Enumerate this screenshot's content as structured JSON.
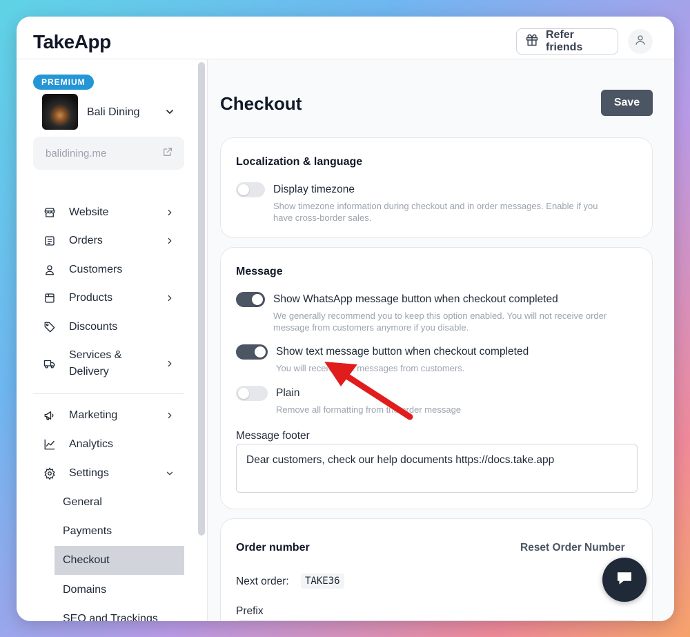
{
  "app": {
    "logo": "TakeApp"
  },
  "header": {
    "refer_label": "Refer friends"
  },
  "sidebar": {
    "badge": "PREMIUM",
    "store_name": "Bali Dining",
    "domain": "balidining.me",
    "items": [
      {
        "label": "Website"
      },
      {
        "label": "Orders"
      },
      {
        "label": "Customers"
      },
      {
        "label": "Products"
      },
      {
        "label": "Discounts"
      },
      {
        "label": "Services &"
      },
      {
        "label": "Delivery"
      },
      {
        "label": "Marketing"
      },
      {
        "label": "Analytics"
      },
      {
        "label": "Settings"
      }
    ],
    "sub_items": [
      {
        "label": "General"
      },
      {
        "label": "Payments"
      },
      {
        "label": "Checkout"
      },
      {
        "label": "Domains"
      },
      {
        "label": "SEO and Trackings"
      }
    ]
  },
  "main": {
    "title": "Checkout",
    "save_label": "Save",
    "localization": {
      "title": "Localization & language",
      "timezone_label": "Display timezone",
      "timezone_desc_1": "Show timezone information during checkout and in order messages. Enable if you",
      "timezone_desc_2": "have cross-border sales.",
      "timezone_on": false
    },
    "message": {
      "title": "Message",
      "whatsapp_label": "Show WhatsApp message button when checkout completed",
      "whatsapp_desc_1": "We generally recommend you to keep this option enabled. You will not receive order",
      "whatsapp_desc_2": "message from customers anymore if you disable.",
      "whatsapp_on": true,
      "text_label": "Show text message button when checkout completed",
      "text_desc": "You will receive text messages from customers.",
      "text_on": true,
      "plain_label": "Plain",
      "plain_desc": "Remove all formatting from the order message",
      "plain_on": false,
      "footer_label": "Message footer",
      "footer_value": "Dear customers, check our help documents https://docs.take.app"
    },
    "order_number": {
      "title": "Order number",
      "reset_label": "Reset Order Number",
      "next_label": "Next order:",
      "next_value": "TAKE36",
      "prefix_label": "Prefix"
    }
  },
  "colors": {
    "accent": "#4b5563",
    "badge": "#2496d6",
    "arrow": "#e11d1d"
  }
}
